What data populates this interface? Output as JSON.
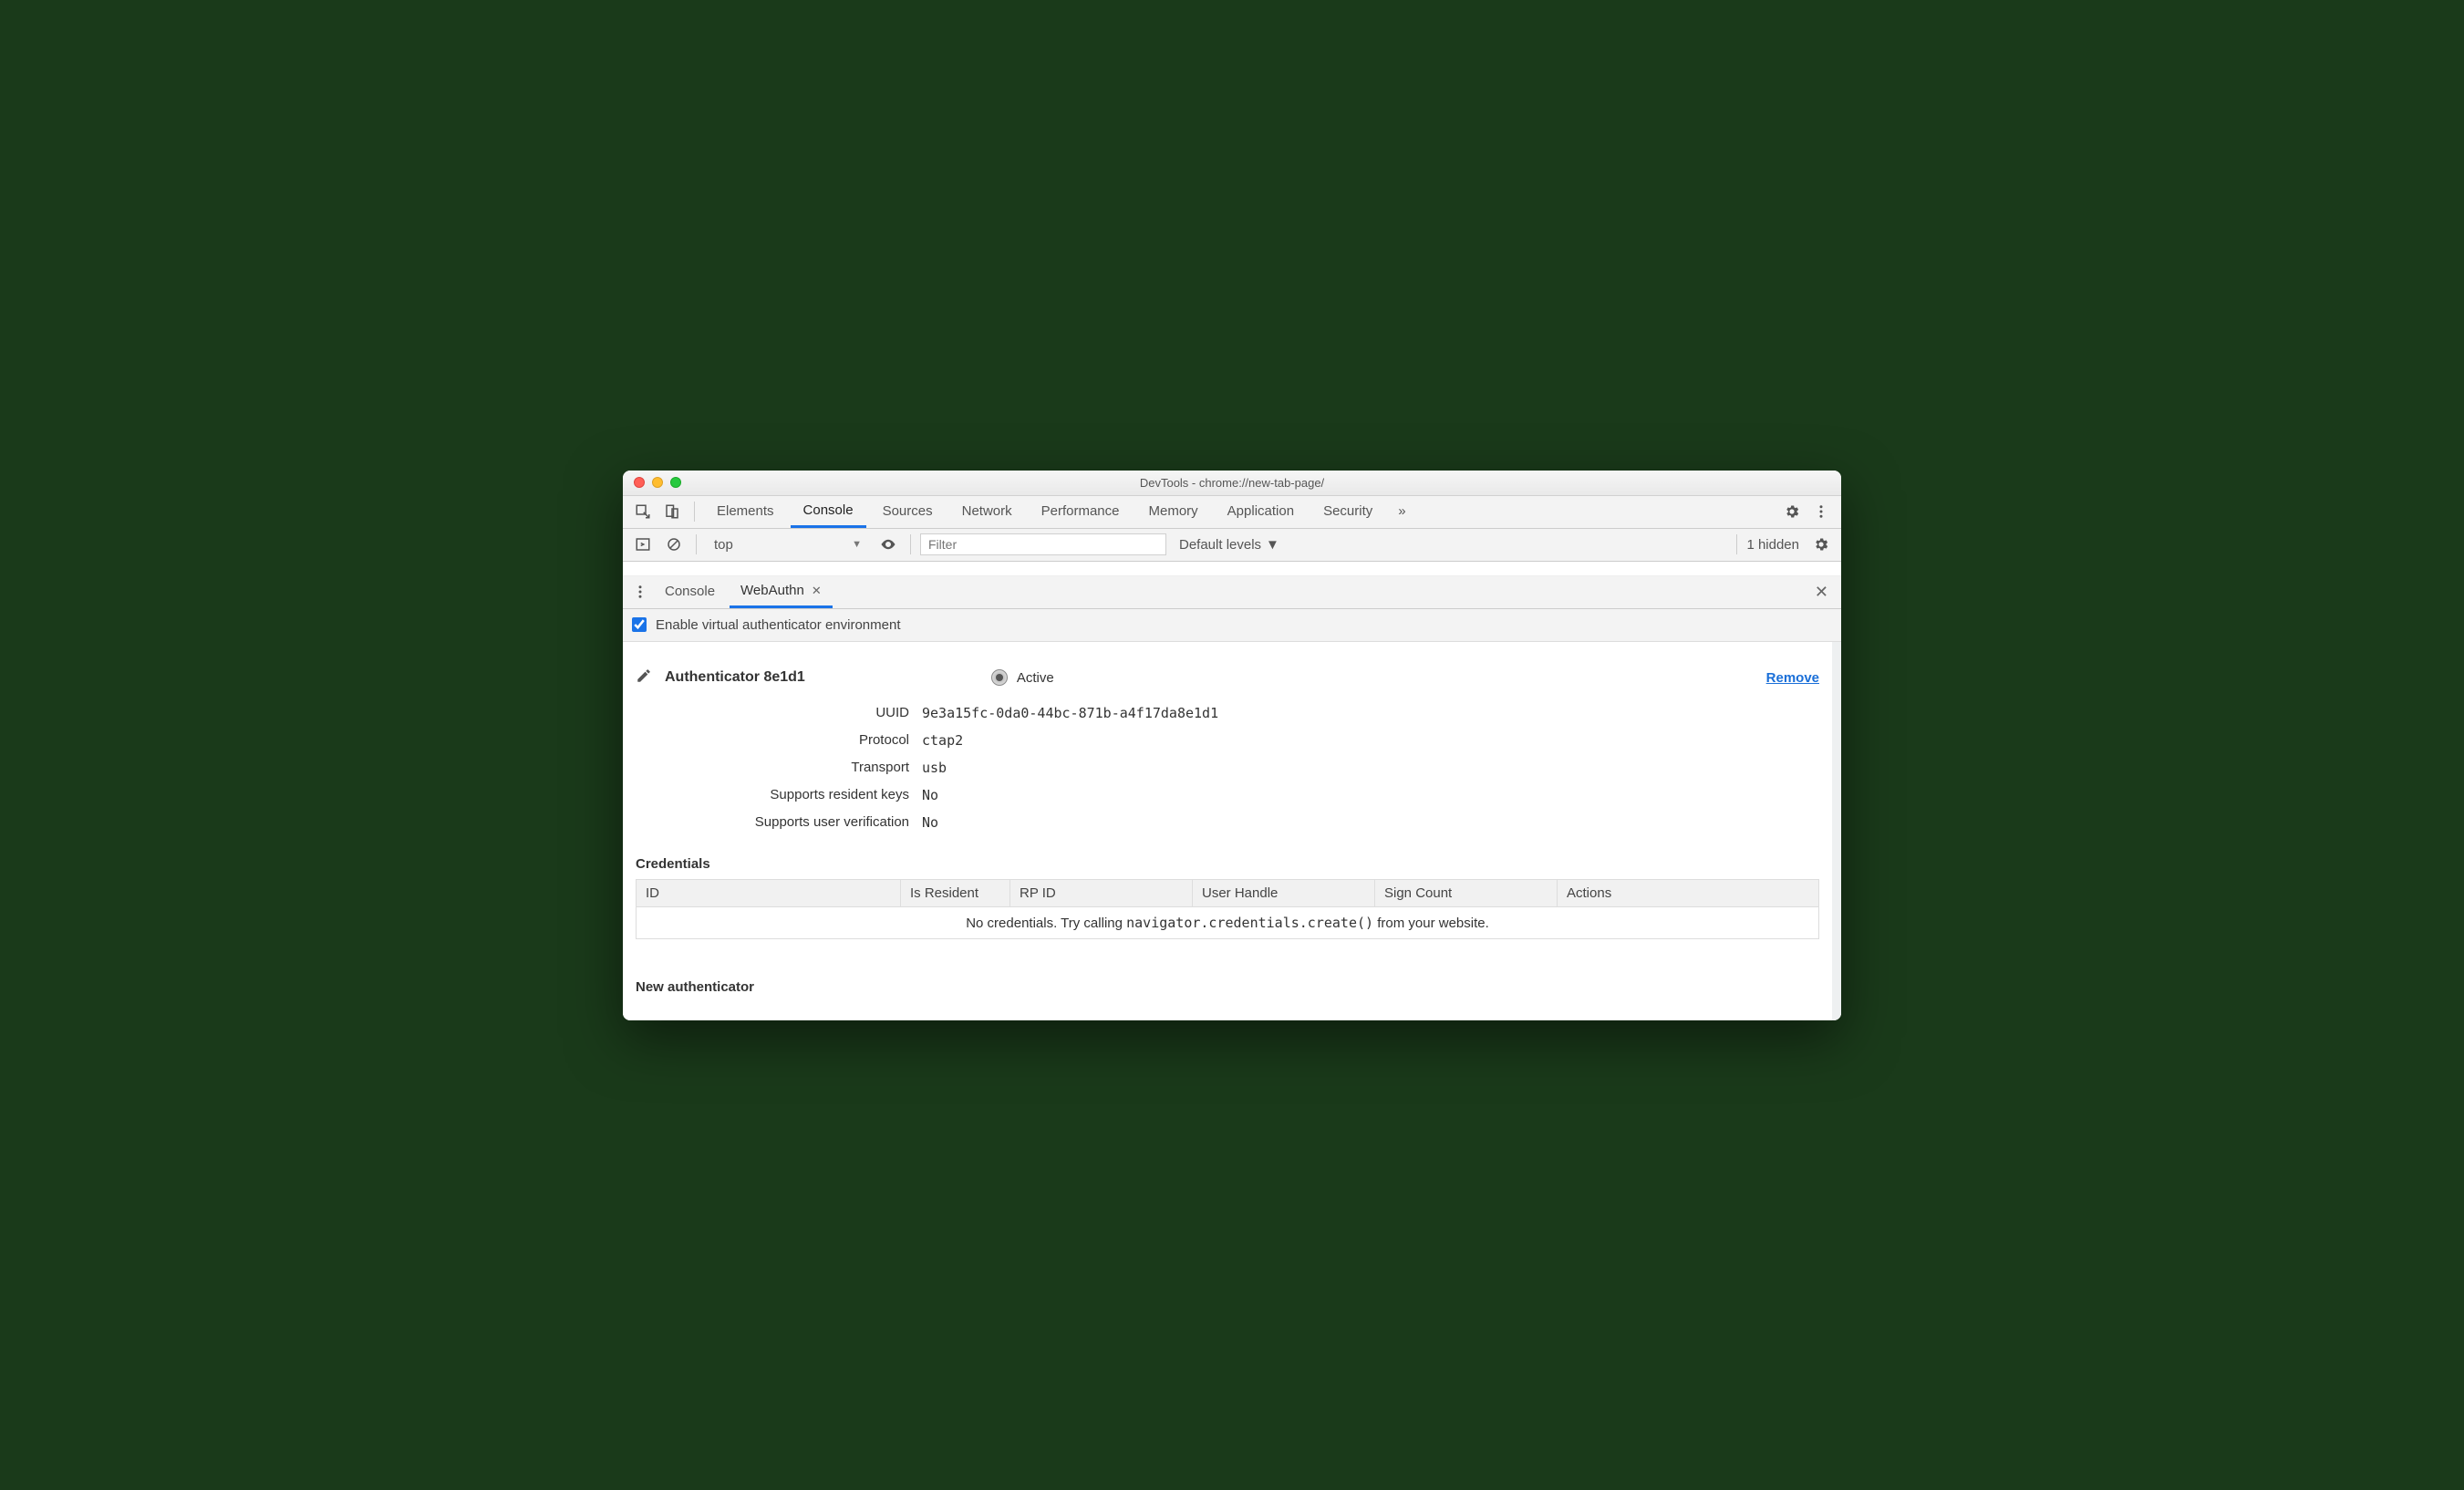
{
  "window": {
    "title": "DevTools - chrome://new-tab-page/"
  },
  "main_tabs": {
    "items": [
      "Elements",
      "Console",
      "Sources",
      "Network",
      "Performance",
      "Memory",
      "Application",
      "Security"
    ],
    "more_glyph": "»",
    "active_index": 1
  },
  "console_toolbar": {
    "context": "top",
    "filter_placeholder": "Filter",
    "levels_label": "Default levels",
    "hidden_label": "1 hidden"
  },
  "drawer": {
    "tabs": [
      {
        "label": "Console",
        "closable": false
      },
      {
        "label": "WebAuthn",
        "closable": true
      }
    ],
    "active_index": 1
  },
  "webauthn": {
    "enable_label": "Enable virtual authenticator environment",
    "enable_checked": true,
    "authenticator": {
      "title": "Authenticator 8e1d1",
      "active_label": "Active",
      "remove_label": "Remove",
      "fields": {
        "uuid_label": "UUID",
        "uuid": "9e3a15fc-0da0-44bc-871b-a4f17da8e1d1",
        "protocol_label": "Protocol",
        "protocol": "ctap2",
        "transport_label": "Transport",
        "transport": "usb",
        "resident_label": "Supports resident keys",
        "resident": "No",
        "userver_label": "Supports user verification",
        "userver": "No"
      }
    },
    "credentials": {
      "title": "Credentials",
      "headers": [
        "ID",
        "Is Resident",
        "RP ID",
        "User Handle",
        "Sign Count",
        "Actions"
      ],
      "empty_prefix": "No credentials. Try calling ",
      "empty_code": "navigator.credentials.create()",
      "empty_suffix": " from your website."
    },
    "new_section_title": "New authenticator"
  }
}
